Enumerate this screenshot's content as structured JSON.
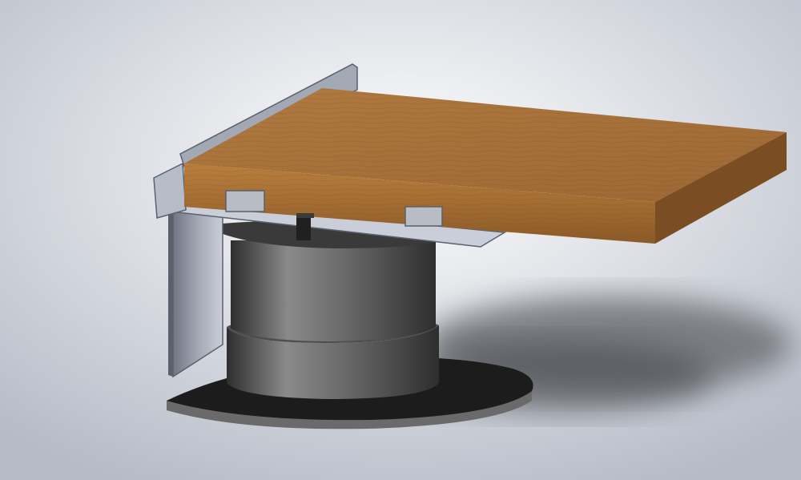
{
  "scene": {
    "subject": "cad-render-wooden-panel-on-metal-bracket-and-pedestal",
    "colors": {
      "background_light": "#ffffff",
      "background_dark": "#b4bac6",
      "wood_top": "#9c6733",
      "wood_top_light": "#b07a40",
      "wood_front": "#b97f3d",
      "wood_front_dark": "#8c5a28",
      "wood_side": "#7a4e22",
      "metal_light": "#c9ced8",
      "metal_mid": "#a2a8b4",
      "metal_dark": "#6f7582",
      "cylinder_light": "#8a8a8a",
      "cylinder_dark": "#2e2e2e",
      "base_top": "#1c1c1c",
      "base_edge": "#6a6a6a",
      "shadow": "#6d6f74",
      "clip": "#b8bcc4",
      "pin": "#202020"
    }
  }
}
